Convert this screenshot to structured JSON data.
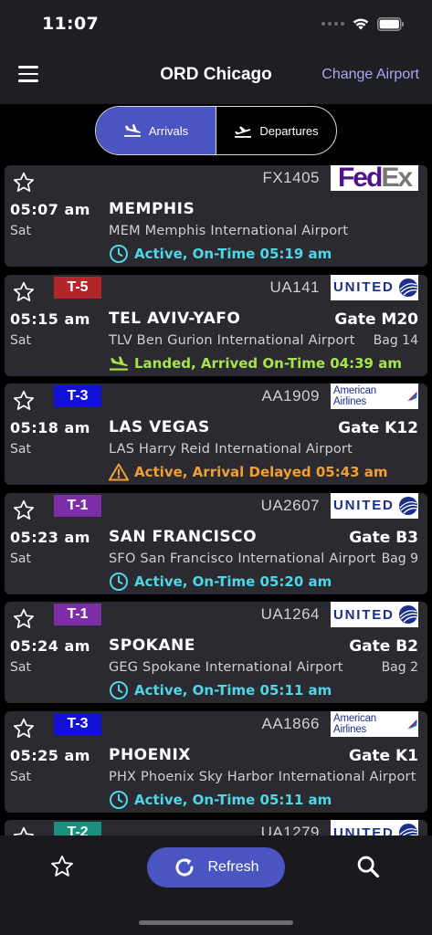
{
  "status_bar": {
    "time": "11:07"
  },
  "nav": {
    "title": "ORD Chicago",
    "change_airport": "Change Airport"
  },
  "segments": [
    {
      "label": "Arrivals",
      "active": true,
      "icon": "plane-landing-icon"
    },
    {
      "label": "Departures",
      "active": false,
      "icon": "plane-takeoff-icon"
    }
  ],
  "flights": [
    {
      "terminal": "",
      "terminal_color": "",
      "flight": "FX1405",
      "airline": "fedex",
      "logo_text_1": "Fed",
      "logo_text_2": "Ex",
      "time": "05:07 am",
      "day": "Sat",
      "city": "MEMPHIS",
      "gate": "",
      "airport": "MEM Memphis International Airport",
      "bag": "",
      "status": "Active, On-Time 05:19 am",
      "status_kind": "clock",
      "status_color": "#4fd6e6"
    },
    {
      "terminal": "T-5",
      "terminal_color": "#b0262b",
      "flight": "UA141",
      "airline": "united",
      "logo_text_1": "UNITED",
      "logo_text_2": "",
      "time": "05:15 am",
      "day": "Sat",
      "city": "TEL AVIV-YAFO",
      "gate": "Gate M20",
      "airport": "TLV Ben Gurion International Airport",
      "bag": "Bag 14",
      "status": "Landed, Arrived On-Time 04:39 am",
      "status_kind": "landed",
      "status_color": "#a9e34b"
    },
    {
      "terminal": "T-3",
      "terminal_color": "#1111d8",
      "flight": "AA1909",
      "airline": "american",
      "logo_text_1": "American Airlines",
      "logo_text_2": "",
      "time": "05:18 am",
      "day": "Sat",
      "city": "LAS VEGAS",
      "gate": "Gate K12",
      "airport": "LAS Harry Reid International Airport",
      "bag": "",
      "status": "Active, Arrival Delayed 05:43 am",
      "status_kind": "warning",
      "status_color": "#f0a030"
    },
    {
      "terminal": "T-1",
      "terminal_color": "#7b2ea6",
      "flight": "UA2607",
      "airline": "united",
      "logo_text_1": "UNITED",
      "logo_text_2": "",
      "time": "05:23 am",
      "day": "Sat",
      "city": "SAN FRANCISCO",
      "gate": "Gate B3",
      "airport": "SFO San Francisco International Airport",
      "bag": "Bag 9",
      "status": "Active, On-Time 05:20 am",
      "status_kind": "clock",
      "status_color": "#4fd6e6"
    },
    {
      "terminal": "T-1",
      "terminal_color": "#7b2ea6",
      "flight": "UA1264",
      "airline": "united",
      "logo_text_1": "UNITED",
      "logo_text_2": "",
      "time": "05:24 am",
      "day": "Sat",
      "city": "SPOKANE",
      "gate": "Gate B2",
      "airport": "GEG Spokane International Airport",
      "bag": "Bag 2",
      "status": "Active, On-Time 05:11 am",
      "status_kind": "clock",
      "status_color": "#4fd6e6"
    },
    {
      "terminal": "T-3",
      "terminal_color": "#1111d8",
      "flight": "AA1866",
      "airline": "american",
      "logo_text_1": "American Airlines",
      "logo_text_2": "",
      "time": "05:25 am",
      "day": "Sat",
      "city": "PHOENIX",
      "gate": "Gate K1",
      "airport": "PHX Phoenix Sky Harbor International Airport",
      "bag": "",
      "status": "Active, On-Time 05:11 am",
      "status_kind": "clock",
      "status_color": "#4fd6e6"
    },
    {
      "terminal": "T-2",
      "terminal_color": "#1a8f80",
      "flight": "UA1279",
      "airline": "united",
      "logo_text_1": "UNITED",
      "logo_text_2": "",
      "time": "",
      "day": "",
      "city": "",
      "gate": "",
      "airport": "",
      "bag": "",
      "status": "",
      "status_kind": "",
      "status_color": "#4fd6e6"
    }
  ],
  "bottom": {
    "refresh": "Refresh"
  }
}
